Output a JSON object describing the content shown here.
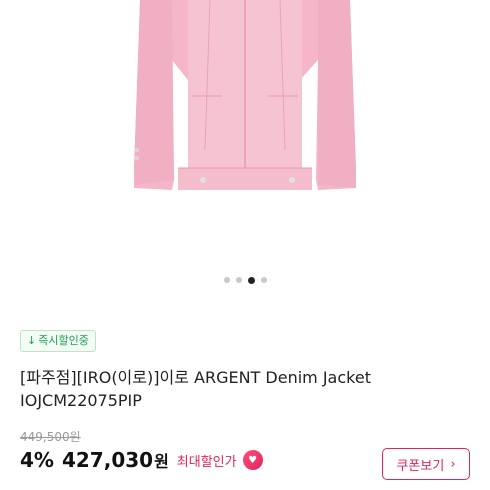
{
  "product": {
    "image_icon": "pink-denim-jacket-photo",
    "carousel": {
      "count": 4,
      "active": 3
    },
    "badge": {
      "icon": "down-arrow-icon",
      "label": "즉시할인중"
    },
    "title": "[파주점][IRO(이로)]이로 ARGENT Denim Jacket IOJCM22075PIP",
    "original_price": "449,500원",
    "discount": "4%",
    "price": "427,030",
    "currency": "원",
    "max_discount_label": "최대할인가",
    "coupon_button": "쿠폰보기",
    "coupon_chevron": "›"
  },
  "colors": {
    "accent": "#e0245e",
    "badge_green": "#1f9d55",
    "jacket_pink": "#f4b6c8"
  }
}
